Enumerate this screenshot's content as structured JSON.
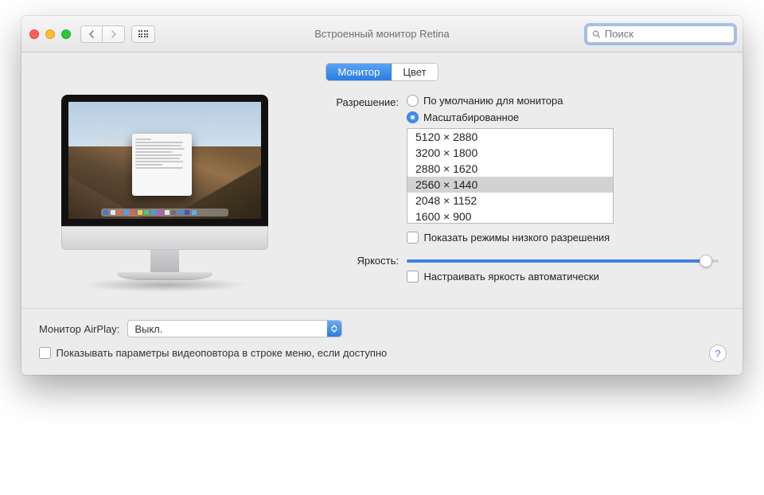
{
  "window": {
    "title": "Встроенный монитор Retina",
    "search_placeholder": "Поиск"
  },
  "tabs": {
    "display": "Монитор",
    "color": "Цвет"
  },
  "labels": {
    "resolution": "Разрешение:",
    "brightness": "Яркость:",
    "airplay": "Монитор AirPlay:"
  },
  "resolution": {
    "default_option": "По умолчанию для монитора",
    "scaled_option": "Масштабированное",
    "options": [
      "5120 × 2880",
      "3200 × 1800",
      "2880 × 1620",
      "2560 × 1440",
      "2048 × 1152",
      "1600 × 900"
    ],
    "selected_index": 3,
    "show_low_res_label": "Показать режимы низкого разрешения"
  },
  "brightness": {
    "auto_label": "Настраивать яркость автоматически"
  },
  "airplay": {
    "selected": "Выкл."
  },
  "mirror_checkbox_label": "Показывать параметры видеоповтора в строке меню, если доступно",
  "help_symbol": "?"
}
